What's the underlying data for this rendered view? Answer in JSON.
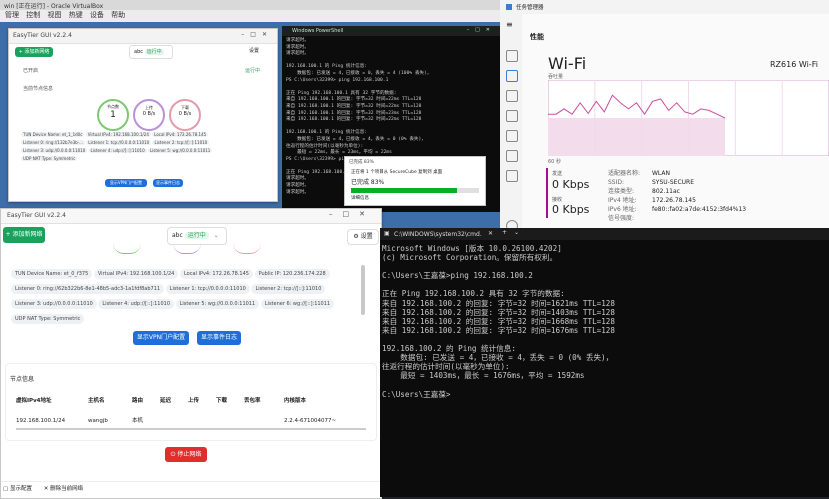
{
  "vbox": {
    "title": "win [正在运行] - Oracle VirtualBox",
    "menu": [
      "管理",
      "控制",
      "视图",
      "热键",
      "设备",
      "帮助"
    ]
  },
  "easytier_back": {
    "title": "EasyTier GUI v2.2.4",
    "add_label": "+ 添加新网络",
    "network_name": "abc",
    "status": "运行中",
    "settings": "设置",
    "started_label": "已开启",
    "run_label": "运行中",
    "current_node_label": "当前节点信息",
    "peer_count": "1",
    "peer_label": "节点数",
    "up_label": "上传",
    "up_value": "0 B/s",
    "down_label": "下载",
    "down_value": "0 B/s",
    "chips": [
      "TUN Device Name: et_1_1d0c",
      "Virtual IPv4: 192.168.100.1/24",
      "Local IPv4: 172.26.78.145",
      "Public IPv4: 120.236.174.228",
      "Listener 0: ring://132b7e3b-...",
      "Listener 1: tcp://0.0.0.0:11010",
      "Listener 2: tcp://[::]:11010",
      "Listener 3: udp://0.0.0.0:11010",
      "Listener 4: udp://[::]:11010",
      "Listener 5: wg://0.0.0.0:11011",
      "Listener 6: wg://[::]:11011",
      "UDP NAT Type: Symmetric"
    ],
    "vpn_btn": "显示VPN门户配置",
    "event_btn": "显示事件日志"
  },
  "powershell": {
    "title": "Windows PowerShell",
    "lines": [
      "请求超时。",
      "请求超时。",
      "请求超时。",
      "",
      "192.168.100.1 的 Ping 统计信息:",
      "    数据包: 已发送 = 4，已接收 = 0，丢失 = 4 (100% 丢失)，",
      "PS C:\\Users\\32399> ping 192.168.100.1",
      "",
      "正在 Ping 192.168.100.1 具有 32 字节的数据:",
      "来自 192.168.100.1 的回复: 字节=32 时间=22ms TTL=128",
      "来自 192.168.100.1 的回复: 字节=32 时间=22ms TTL=128",
      "来自 192.168.100.1 的回复: 字节=32 时间=23ms TTL=128",
      "来自 192.168.100.1 的回复: 字节=32 时间=22ms TTL=128",
      "",
      "192.168.100.1 的 Ping 统计信息:",
      "    数据包: 已发送 = 4，已接收 = 4，丢失 = 0 (0% 丢失)，",
      "往返行程的估计时间(以毫秒为单位):",
      "    最短 = 22ms，最长 = 23ms，平均 = 22ms",
      "PS C:\\Users\\32399> ping 192.168.100.1",
      "",
      "正在 Ping 192.168.100.1 具有 32 字节的数据:",
      "请求超时。",
      "请求超时。",
      "请求超时。"
    ]
  },
  "copy_dialog": {
    "title": "已完成 83%",
    "line1": "正在将 1 个项目从 SecureCube 复制到 桌面",
    "line2": "已完成 83%",
    "details": "详细信息",
    "progress": 0.83
  },
  "easytier_front": {
    "title": "EasyTier GUI v2.2.4",
    "add_label": "+ 添加新网络",
    "network_name": "abc",
    "status": "运行中",
    "settings": "设置",
    "chips": [
      "TUN Device Name: et_0_f375",
      "Virtual IPv4: 192.168.100.1/24",
      "Local IPv4: 172.26.78.145",
      "Public IP: 120.236.174.228",
      "Listener 0: ring://62b322b6-8e1-48b5-adc3-1a1fdf8ab711",
      "Listener 1: tcp://0.0.0.0:11010",
      "Listener 2: tcp://[::]:11010",
      "Listener 3: udp://0.0.0.0:11010",
      "Listener 4: udp://[::]:11010",
      "Listener 5: wg://0.0.0.0:11011",
      "Listener 6: wg://[::]:11011",
      "UDP NAT Type: Symmetric"
    ],
    "vpn_btn": "显示VPN门户配置",
    "event_btn": "显示事件日志",
    "node_info_label": "节点信息",
    "table_headers": [
      "虚拟IPv4地址",
      "主机名",
      "路由",
      "延迟",
      "上传",
      "下载",
      "丢包率",
      "内核版本"
    ],
    "table_row": [
      "192.168.100.1/24",
      "wangjb",
      "本机",
      "",
      "",
      "",
      "",
      "2.2.4-671004077~"
    ],
    "stop_btn": "停止网络",
    "footer_left": "显示配置",
    "footer_right": "删除当前网络"
  },
  "taskmgr": {
    "title": "任务管理器",
    "section": "性能",
    "net_name": "Wi-Fi",
    "adapter": "RZ616 Wi-Fi",
    "throughput_label": "吞吐量",
    "time_label": "60 秒",
    "send_label": "发送",
    "send_value": "0 Kbps",
    "recv_label": "接收",
    "recv_value": "0 Kbps",
    "details": [
      {
        "k": "适配器名称:",
        "v": "WLAN"
      },
      {
        "k": "SSID:",
        "v": "SYSU-SECURE"
      },
      {
        "k": "连接类型:",
        "v": "802.11ac"
      },
      {
        "k": "IPv4 地址:",
        "v": "172.26.78.145"
      },
      {
        "k": "IPv6 地址:",
        "v": "fe80::fa02:a7de:4152:3fd4%13"
      },
      {
        "k": "信号强度:",
        "v": ""
      }
    ],
    "graph": {
      "curve": [
        0.55,
        0.55,
        0.62,
        0.55,
        0.7,
        0.56,
        0.72,
        0.58,
        0.8,
        0.7,
        0.62,
        0.7,
        0.55,
        0.72,
        0.75,
        0.6,
        0.7,
        0.58,
        0.55,
        0.62,
        0.6,
        0.55,
        0.5
      ]
    }
  },
  "cmd_main": {
    "title": "C:\\WINDOWS\\system32\\cmd.",
    "lines": [
      "Microsoft Windows [版本 10.0.26100.4202]",
      "(c) Microsoft Corporation。保留所有权利。",
      "",
      "C:\\Users\\王嘉葆>ping 192.168.100.2",
      "",
      "正在 Ping 192.168.100.2 具有 32 字节的数据:",
      "来自 192.168.100.2 的回复: 字节=32 时间=1621ms TTL=128",
      "来自 192.168.100.2 的回复: 字节=32 时间=1403ms TTL=128",
      "来自 192.168.100.2 的回复: 字节=32 时间=1668ms TTL=128",
      "来自 192.168.100.2 的回复: 字节=32 时间=1676ms TTL=128",
      "",
      "192.168.100.2 的 Ping 统计信息:",
      "    数据包: 已发送 = 4，已接收 = 4，丢失 = 0 (0% 丢失)，",
      "往返行程的估计时间(以毫秒为单位):",
      "    最短 = 1403ms，最长 = 1676ms，平均 = 1592ms",
      "",
      "C:\\Users\\王嘉葆>"
    ]
  }
}
